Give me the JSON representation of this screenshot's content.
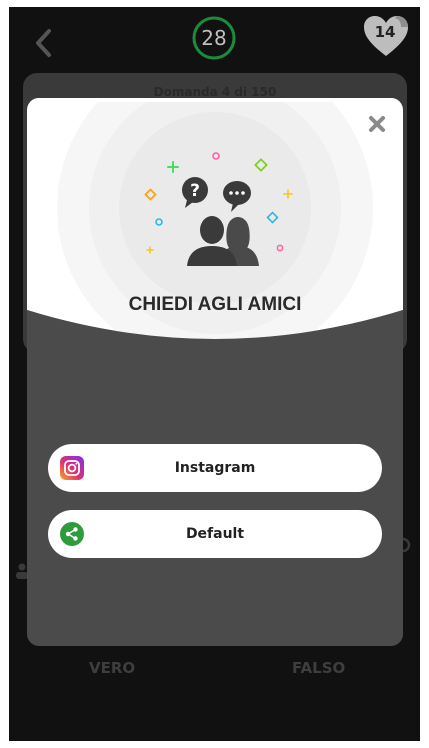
{
  "top_bar": {
    "timer": "28",
    "lives": "14"
  },
  "question": {
    "counter": "Domanda 4 di 150"
  },
  "answers": {
    "true_label": "VERO",
    "false_label": "FALSO"
  },
  "modal": {
    "title": "CHIEDI AGLI AMICI",
    "buttons": [
      {
        "label": "Instagram",
        "icon": "instagram-icon"
      },
      {
        "label": "Default",
        "icon": "share-icon"
      }
    ]
  },
  "colors": {
    "timer_ring": "#1b8c3a",
    "share_green": "#2e9c3c",
    "modal_body": "#4b4b4b",
    "screen_bg": "#111111"
  }
}
